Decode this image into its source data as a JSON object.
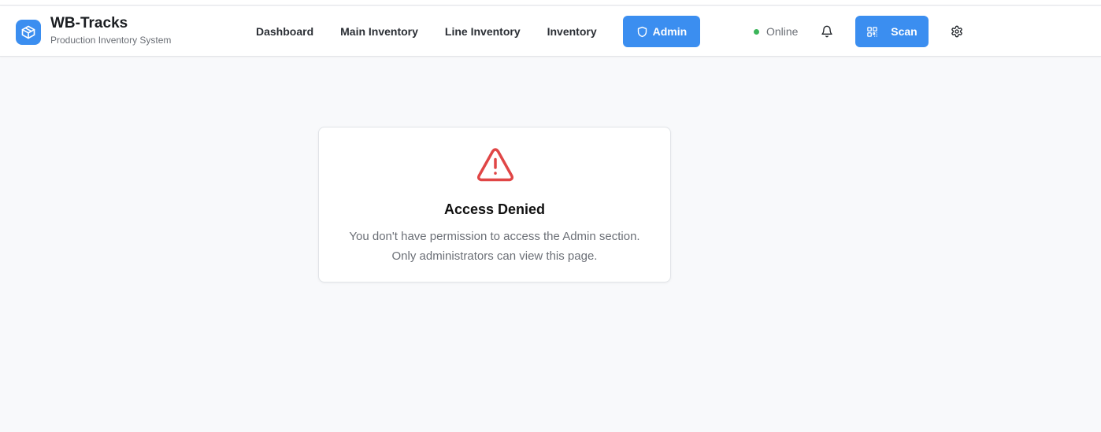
{
  "app": {
    "title": "WB-Tracks",
    "subtitle": "Production Inventory System",
    "logo_icon": "box-icon"
  },
  "nav": {
    "items": [
      {
        "label": "Dashboard",
        "active": false
      },
      {
        "label": "Main Inventory",
        "active": false
      },
      {
        "label": "Line Inventory",
        "active": false
      },
      {
        "label": "Inventory",
        "active": false
      },
      {
        "label": "Admin",
        "active": true,
        "icon": "shield-icon"
      }
    ]
  },
  "status": {
    "label": "Online",
    "color": "#3bb55a"
  },
  "toolbar": {
    "scan_label": "Scan",
    "scan_icon": "qr-code-icon",
    "bell_icon": "bell-icon",
    "settings_icon": "gear-icon"
  },
  "access": {
    "icon": "warning-triangle-icon",
    "title": "Access Denied",
    "line1": "You don't have permission to access the Admin section.",
    "line2": "Only administrators can view this page."
  },
  "colors": {
    "accent": "#3b8ef0",
    "warning": "#e04646",
    "background": "#f8f9fb"
  }
}
